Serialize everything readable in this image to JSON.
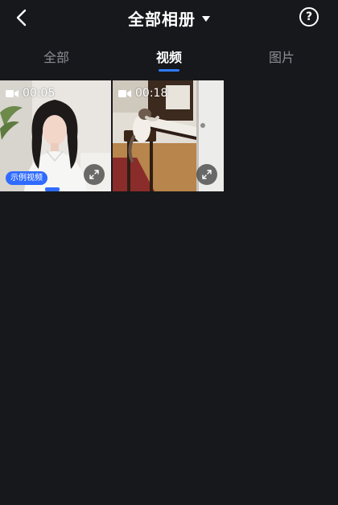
{
  "header": {
    "title": "全部相册"
  },
  "tabs": [
    {
      "label": "全部",
      "active": false
    },
    {
      "label": "视频",
      "active": true
    },
    {
      "label": "图片",
      "active": false
    }
  ],
  "help_label": "?",
  "accent_color": "#2f7bff",
  "media": [
    {
      "type": "video",
      "duration": "00:05",
      "badge": "示例视频"
    },
    {
      "type": "video",
      "duration": "00:18"
    }
  ]
}
